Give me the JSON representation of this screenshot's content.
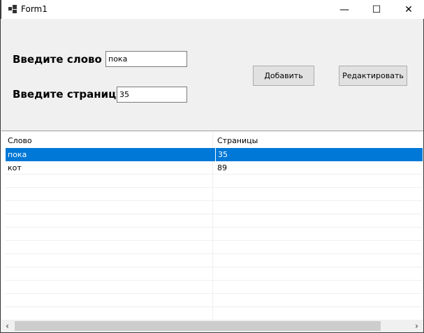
{
  "window": {
    "title": "Form1",
    "minimize": "—",
    "maximize": "☐",
    "close": "✕"
  },
  "form": {
    "word_label": "Введите слово",
    "word_value": "пока",
    "page_label": "Введите страницу",
    "page_value": "35",
    "add_button": "Добавить",
    "edit_button": "Редактировать"
  },
  "table": {
    "columns": [
      "Слово",
      "Страницы"
    ],
    "rows": [
      [
        "пока",
        "35"
      ],
      [
        "кот",
        "89"
      ]
    ],
    "selected_color": "#0078d7"
  },
  "scrollbar": {
    "left": "‹",
    "right": "›"
  }
}
